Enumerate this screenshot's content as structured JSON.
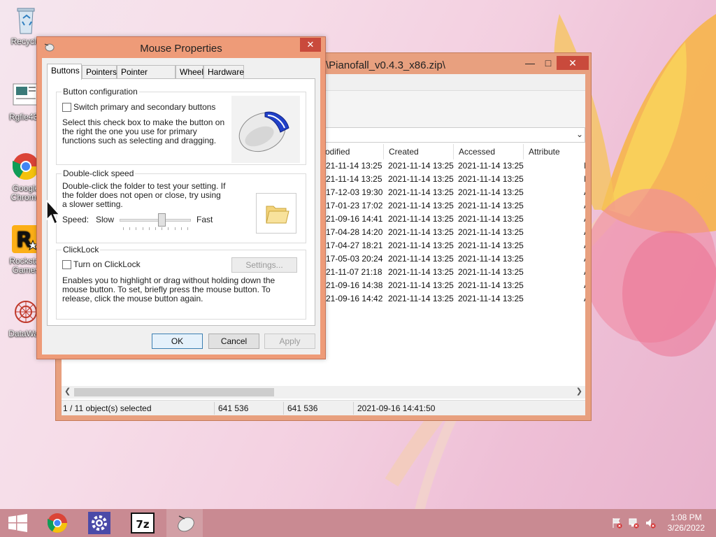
{
  "desktop": {
    "icons": [
      {
        "label": "Recycle"
      },
      {
        "label": "Rgfie434"
      },
      {
        "label": "Google Chrome"
      },
      {
        "label": "Rockstar Games"
      },
      {
        "label": "DataWag"
      }
    ]
  },
  "zip_window": {
    "title": "\\Pianofall_v0.4.3_x86.zip\\",
    "controls": {
      "minimize": "—",
      "maximize": "□",
      "close": "✕"
    },
    "columns": [
      "odified",
      "Created",
      "Accessed",
      "Attribute"
    ],
    "rows": [
      {
        "modified": "21-11-14 13:25",
        "created": "2021-11-14 13:25",
        "accessed": "2021-11-14 13:25",
        "attr": "I"
      },
      {
        "modified": "21-11-14 13:25",
        "created": "2021-11-14 13:25",
        "accessed": "2021-11-14 13:25",
        "attr": "I"
      },
      {
        "modified": "17-12-03 19:30",
        "created": "2021-11-14 13:25",
        "accessed": "2021-11-14 13:25",
        "attr": "A"
      },
      {
        "modified": "17-01-23 17:02",
        "created": "2021-11-14 13:25",
        "accessed": "2021-11-14 13:25",
        "attr": "A"
      },
      {
        "modified": "21-09-16 14:41",
        "created": "2021-11-14 13:25",
        "accessed": "2021-11-14 13:25",
        "attr": "A"
      },
      {
        "modified": "17-04-28 14:20",
        "created": "2021-11-14 13:25",
        "accessed": "2021-11-14 13:25",
        "attr": "A"
      },
      {
        "modified": "17-04-27 18:21",
        "created": "2021-11-14 13:25",
        "accessed": "2021-11-14 13:25",
        "attr": "A"
      },
      {
        "modified": "17-05-03 20:24",
        "created": "2021-11-14 13:25",
        "accessed": "2021-11-14 13:25",
        "attr": "A"
      },
      {
        "modified": "21-11-07 21:18",
        "created": "2021-11-14 13:25",
        "accessed": "2021-11-14 13:25",
        "attr": "A"
      },
      {
        "modified": "21-09-16 14:38",
        "created": "2021-11-14 13:25",
        "accessed": "2021-11-14 13:25",
        "attr": "A"
      },
      {
        "modified": "21-09-16 14:42",
        "created": "2021-11-14 13:25",
        "accessed": "2021-11-14 13:25",
        "attr": "A"
      }
    ],
    "status": {
      "selection": "1 / 11 object(s) selected",
      "size": "641 536",
      "packed": "641 536",
      "date": "2021-09-16 14:41:50"
    }
  },
  "dialog": {
    "title": "Mouse Properties",
    "close": "✕",
    "tabs": [
      "Buttons",
      "Pointers",
      "Pointer Options",
      "Wheel",
      "Hardware"
    ],
    "active_tab": "Buttons",
    "button_config": {
      "title": "Button configuration",
      "checkbox_label": "Switch primary and secondary buttons",
      "checked": false,
      "description": "Select this check box to make the button on the right the one you use for primary functions such as selecting and dragging."
    },
    "double_click": {
      "title": "Double-click speed",
      "description": "Double-click the folder to test your setting. If the folder does not open or close, try using a slower setting.",
      "speed_label": "Speed:",
      "slow_label": "Slow",
      "fast_label": "Fast",
      "slider_value": 0.6
    },
    "clicklock": {
      "title": "ClickLock",
      "checkbox_label": "Turn on ClickLock",
      "checked": false,
      "settings_button": "Settings...",
      "description": "Enables you to highlight or drag without holding down the mouse button. To set, briefly press the mouse button. To release, click the mouse button again."
    },
    "buttons": {
      "ok": "OK",
      "cancel": "Cancel",
      "apply": "Apply"
    }
  },
  "taskbar": {
    "items": [
      "start-icon",
      "chrome-icon",
      "settings-icon",
      "7zip-icon",
      "mouse-icon"
    ],
    "active_item": "mouse-icon",
    "seven_zip_text": "7z",
    "clock": {
      "time": "1:08 PM",
      "date": "3/26/2022"
    }
  }
}
